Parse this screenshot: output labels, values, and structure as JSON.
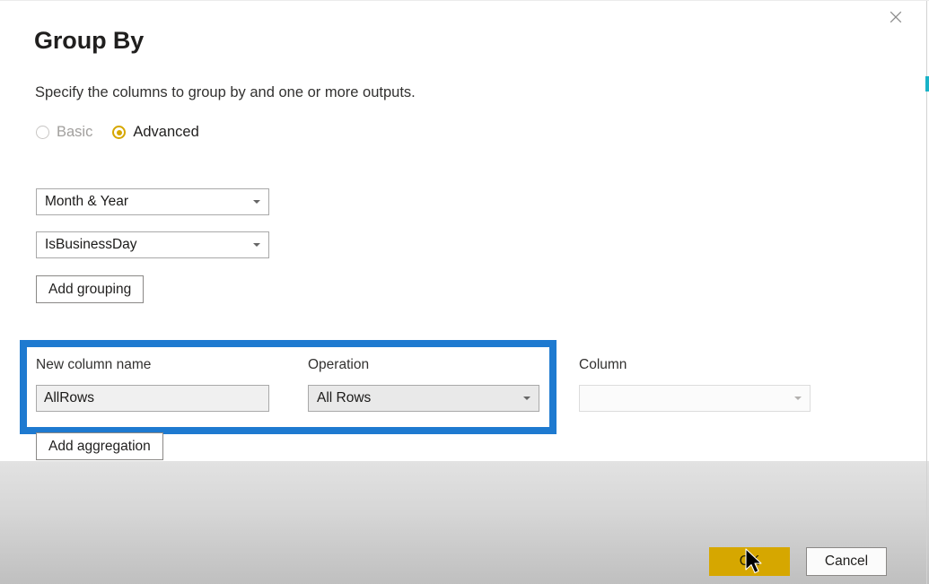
{
  "dialog": {
    "title": "Group By",
    "description": "Specify the columns to group by and one or more outputs.",
    "close_icon": "close-icon"
  },
  "mode": {
    "options": [
      {
        "label": "Basic",
        "selected": false,
        "enabled": false
      },
      {
        "label": "Advanced",
        "selected": true,
        "enabled": true
      }
    ],
    "selected_value": "Advanced",
    "accent_color": "#d6a700"
  },
  "grouping": {
    "rows": [
      {
        "value": "Month & Year",
        "arrow_icon": "chevron-down-icon"
      },
      {
        "value": "IsBusinessDay",
        "arrow_icon": "chevron-down-icon"
      }
    ],
    "add_button_label": "Add grouping"
  },
  "aggregation": {
    "headers": {
      "new_column_name": "New column name",
      "operation": "Operation",
      "column": "Column"
    },
    "rows": [
      {
        "new_column_name_value": "AllRows",
        "new_column_name_placeholder": "",
        "operation_value": "All Rows",
        "column_value": "",
        "column_placeholder": "",
        "column_enabled": false
      }
    ],
    "add_button_label": "Add aggregation",
    "highlight_color": "#1e7ad0"
  },
  "footer": {
    "ok_label": "OK",
    "cancel_label": "Cancel",
    "ok_color": "#d6a700"
  },
  "chrome": {
    "accent_mark_color": "#1ab3c8"
  }
}
